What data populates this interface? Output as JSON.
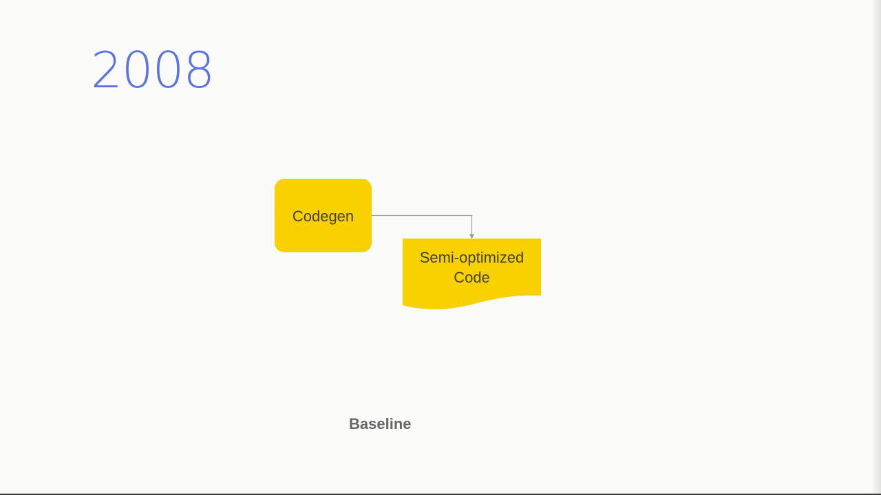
{
  "slide": {
    "year": "2008",
    "caption": "Baseline"
  },
  "diagram": {
    "process_node": {
      "label": "Codegen",
      "shape": "rounded-rectangle"
    },
    "document_node": {
      "label_line1": "Semi-optimized",
      "label_line2": "Code",
      "shape": "document"
    },
    "edge": {
      "from": "Codegen",
      "to": "Semi-optimized Code"
    }
  },
  "colors": {
    "background": "#fafaf9",
    "year_text": "#5b72e0",
    "node_fill": "#f9d100",
    "node_text": "#424242",
    "connector": "#9e9e9e",
    "caption_text": "#666666"
  }
}
